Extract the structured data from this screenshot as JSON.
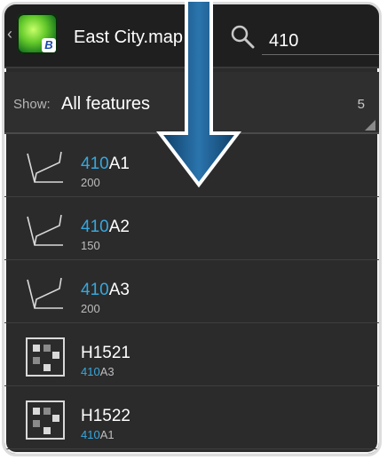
{
  "header": {
    "title": "East City.map",
    "search_query": "410",
    "app_icon_badge": "B"
  },
  "filter": {
    "label": "Show:",
    "value": "All features",
    "count": "5"
  },
  "results": [
    {
      "icon": "line-feature-icon",
      "title_match": "410",
      "title_rest": "A1",
      "sub_match": "",
      "sub_rest": "200"
    },
    {
      "icon": "line-feature-icon",
      "title_match": "410",
      "title_rest": "A2",
      "sub_match": "",
      "sub_rest": "150"
    },
    {
      "icon": "line-feature-icon",
      "title_match": "410",
      "title_rest": "A3",
      "sub_match": "",
      "sub_rest": "200"
    },
    {
      "icon": "area-feature-icon",
      "title_match": "",
      "title_rest": "H1521",
      "sub_match": "410",
      "sub_rest": "A3"
    },
    {
      "icon": "area-feature-icon",
      "title_match": "",
      "title_rest": "H1522",
      "sub_match": "410",
      "sub_rest": "A1"
    }
  ],
  "colors": {
    "highlight": "#37a7de",
    "background": "#2b2b2b",
    "arrow": "#1b5a8a"
  }
}
